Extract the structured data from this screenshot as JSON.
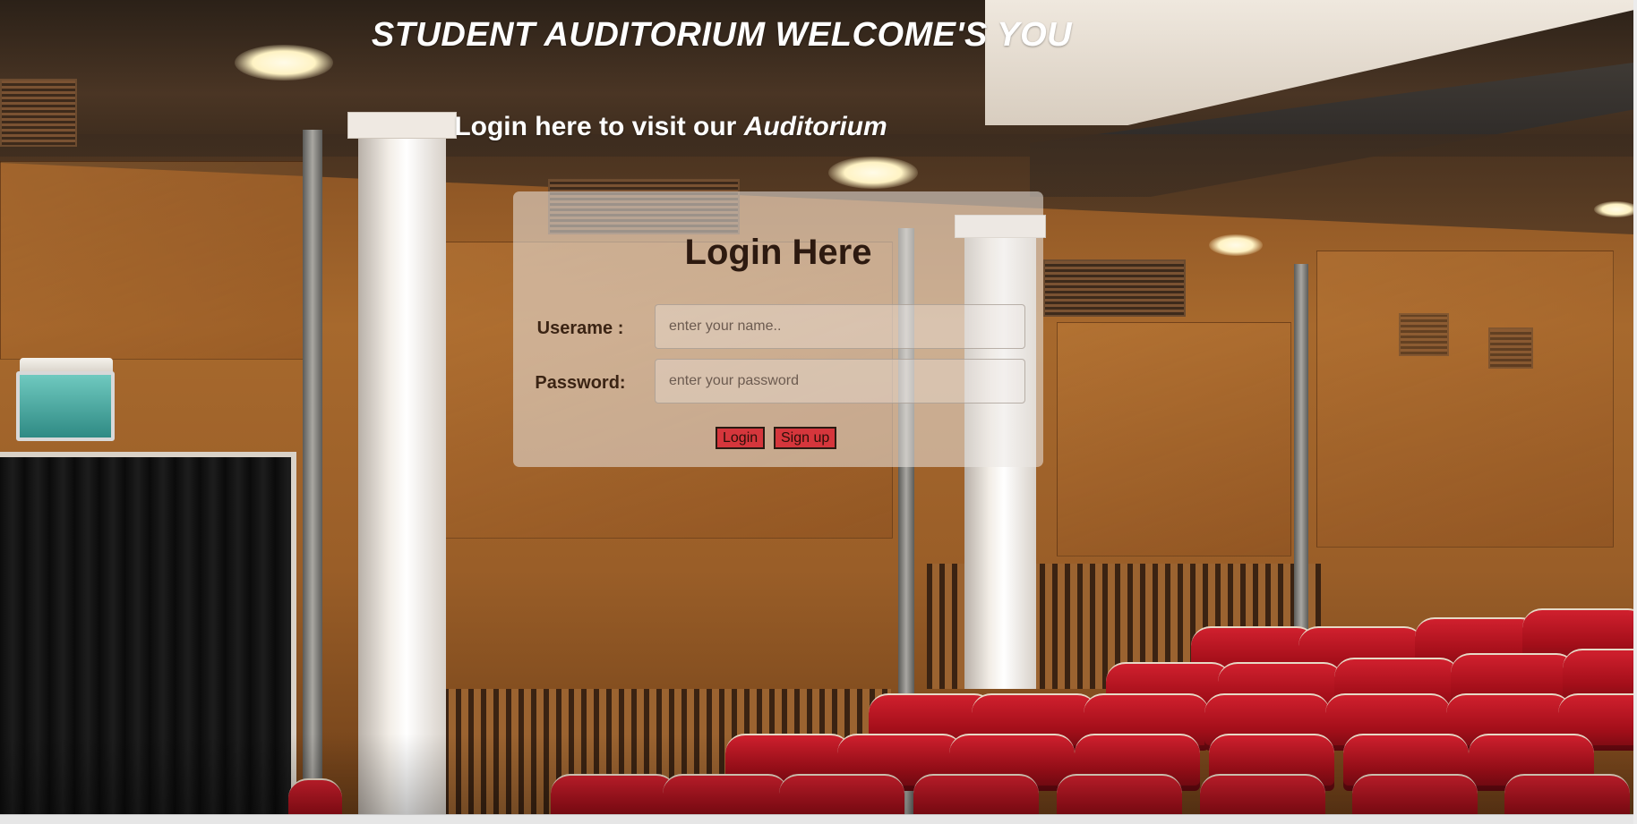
{
  "header": {
    "title": "STUDENT AUDITORIUM WELCOME'S YOU",
    "subtitle_prefix": "Login here to visit our ",
    "subtitle_emphasis": "Auditorium"
  },
  "login": {
    "heading": "Login Here",
    "username_label": "Userame :",
    "username_placeholder": "enter your name..",
    "password_label": "Password:",
    "password_placeholder": "enter your password",
    "login_button": "Login",
    "signup_button": "Sign up"
  },
  "colors": {
    "button_bg": "#d5363c",
    "heading_text": "#2d1a10",
    "title_text": "#ffffff"
  }
}
